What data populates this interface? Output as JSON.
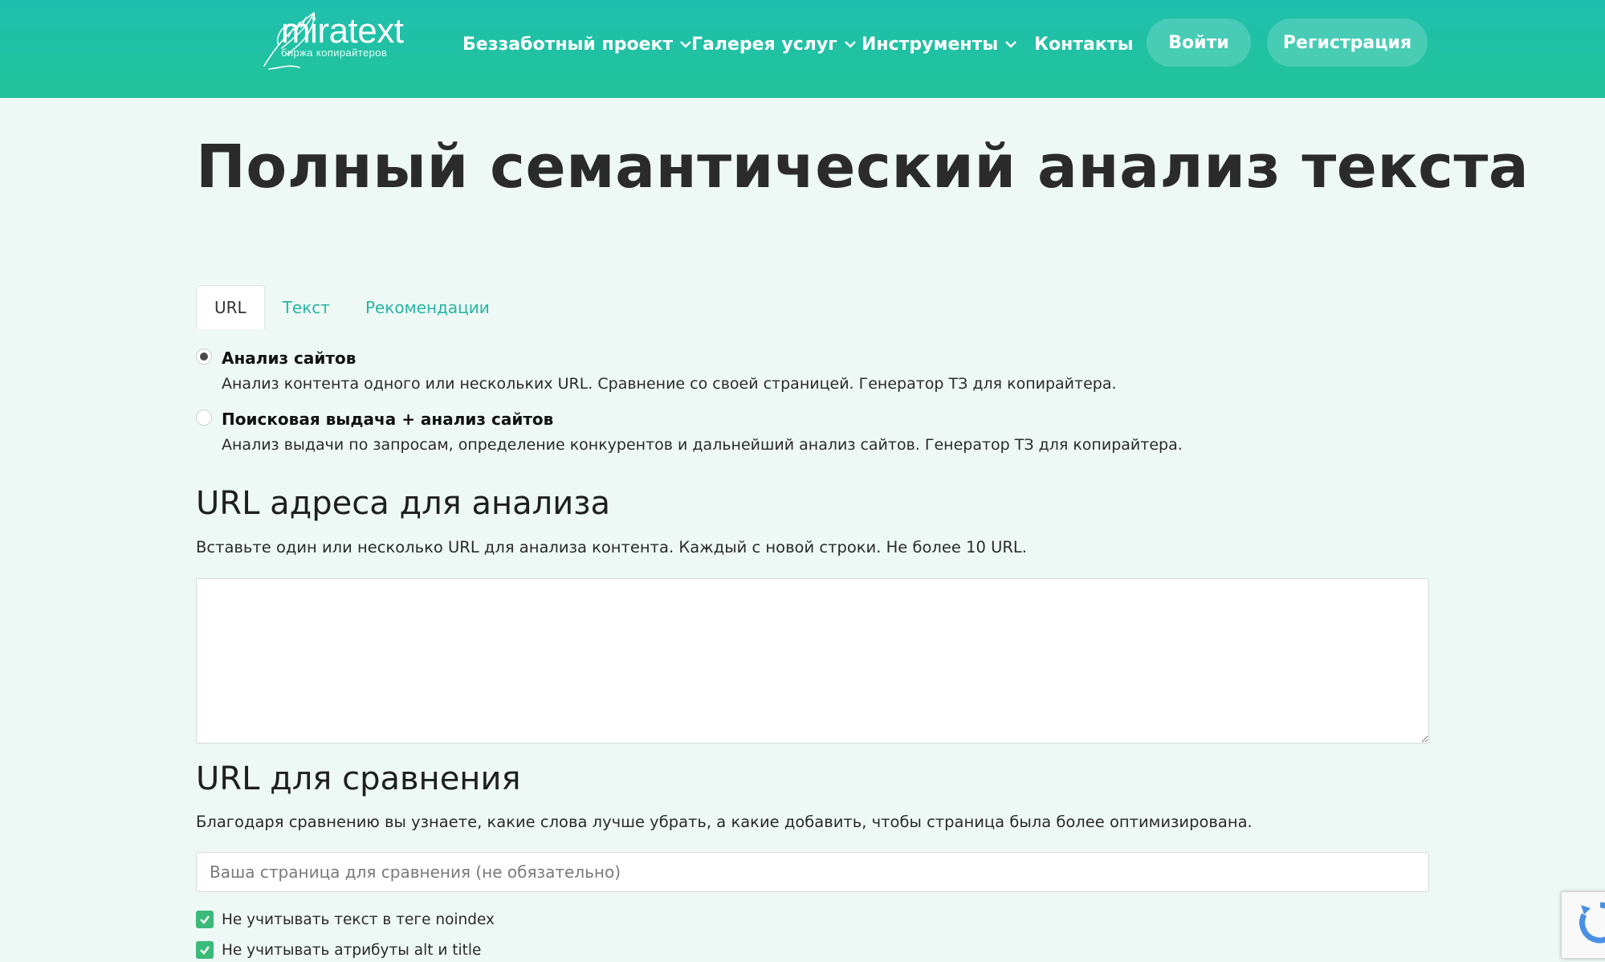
{
  "brand": {
    "name": "miratext",
    "tagline": "биржа копирайтеров"
  },
  "nav": {
    "items": [
      {
        "label": "Беззаботный проект",
        "has_dropdown": true
      },
      {
        "label": "Галерея услуг",
        "has_dropdown": true
      },
      {
        "label": "Инструменты",
        "has_dropdown": true
      },
      {
        "label": "Контакты",
        "has_dropdown": false
      }
    ],
    "login": "Войти",
    "register": "Регистрация"
  },
  "page": {
    "title": "Полный семантический анализ текста"
  },
  "tabs": [
    {
      "label": "URL",
      "active": true
    },
    {
      "label": "Текст",
      "active": false
    },
    {
      "label": "Рекомендации",
      "active": false
    }
  ],
  "modes": [
    {
      "title": "Анализ сайтов",
      "description": "Анализ контента одного или нескольких URL. Сравнение со своей страницей. Генератор ТЗ для копирайтера.",
      "checked": true
    },
    {
      "title": "Поисковая выдача + анализ сайтов",
      "description": "Анализ выдачи по запросам, определение конкурентов и дальнейший анализ сайтов. Генератор ТЗ для копирайтера.",
      "checked": false
    }
  ],
  "urls_section": {
    "heading": "URL адреса для анализа",
    "hint": "Вставьте один или несколько URL для анализа контента. Каждый с новой строки. Не более 10 URL.",
    "value": ""
  },
  "compare_section": {
    "heading": "URL для сравнения",
    "hint": "Благодаря сравнению вы узнаете, какие слова лучше убрать, а какие добавить, чтобы страница была более оптимизирована.",
    "placeholder": "Ваша страница для сравнения (не обязательно)",
    "value": ""
  },
  "options": [
    {
      "label": "Не учитывать текст в теге noindex",
      "checked": true
    },
    {
      "label": "Не учитывать атрибуты alt и title",
      "checked": true
    }
  ],
  "colors": {
    "header": "#1fbfae",
    "accent": "#25b5a2",
    "checkbox": "#3cba7a",
    "background": "#eef9f6"
  }
}
